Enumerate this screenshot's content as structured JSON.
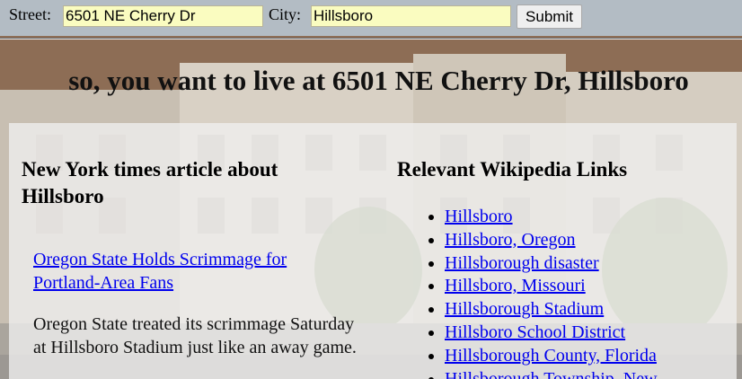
{
  "form": {
    "street_label": "Street:",
    "street_value": "6501 NE Cherry Dr",
    "city_label": "City:",
    "city_value": "Hillsboro",
    "submit_label": "Submit"
  },
  "headline": "so, you want to live at 6501 NE Cherry Dr, Hillsboro",
  "nyt": {
    "heading": "New York times article about Hillsboro",
    "article_title": "Oregon State Holds Scrimmage for Portland-Area Fans",
    "article_snippet": "Oregon State treated its scrimmage Saturday at Hillsboro Stadium just like an away game."
  },
  "wiki": {
    "heading": "Relevant Wikipedia Links",
    "links": [
      "Hillsboro",
      "Hillsboro, Oregon",
      "Hillsborough disaster",
      "Hillsboro, Missouri",
      "Hillsborough Stadium",
      "Hillsboro School District",
      "Hillsborough County, Florida",
      "Hillsborough Township, New"
    ]
  },
  "colors": {
    "input_bg": "#fafcc0",
    "link": "#0000ee",
    "panel_bg": "rgba(240,240,240,0.78)"
  },
  "background_image": "apartment-building-street-view-photo"
}
